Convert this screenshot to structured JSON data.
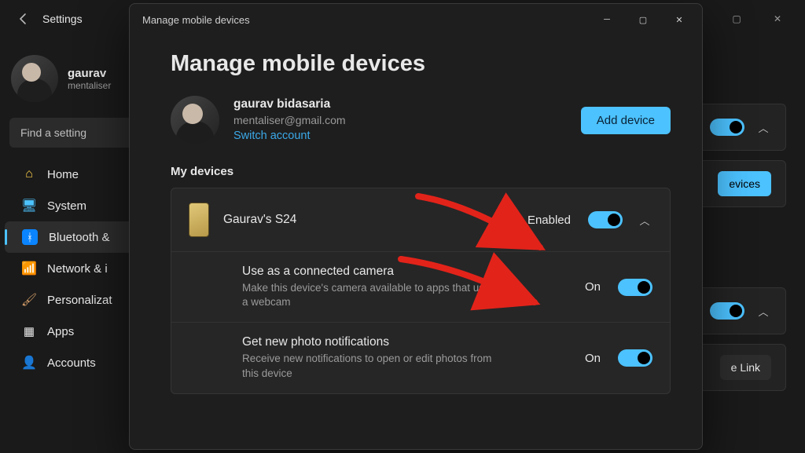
{
  "settings": {
    "title": "Settings",
    "user_name": "gaurav",
    "user_tag": "mentaliser",
    "search_placeholder": "Find a setting",
    "nav": {
      "home": "Home",
      "system": "System",
      "bluetooth": "Bluetooth &",
      "network": "Network & i",
      "personalization": "Personalizat",
      "apps": "Apps",
      "accounts": "Accounts"
    },
    "bg_page_title_fragment": "evices",
    "bg_btn_devices_fragment": "evices",
    "bg_btn_link_fragment": " e Link"
  },
  "modal": {
    "window_title": "Manage mobile devices",
    "heading": "Manage mobile devices",
    "account": {
      "name": "gaurav bidasaria",
      "email": "mentaliser@gmail.com",
      "switch": "Switch account"
    },
    "add_device_btn": "Add device",
    "section_label": "My devices",
    "device": {
      "name": "Gaurav's S24",
      "status": "Enabled"
    },
    "camera": {
      "title": "Use as a connected camera",
      "desc": "Make this device's camera available to apps that use a webcam",
      "status": "On"
    },
    "photos": {
      "title": "Get new photo notifications",
      "desc": "Receive new notifications to open or edit photos from this device",
      "status": "On"
    }
  }
}
